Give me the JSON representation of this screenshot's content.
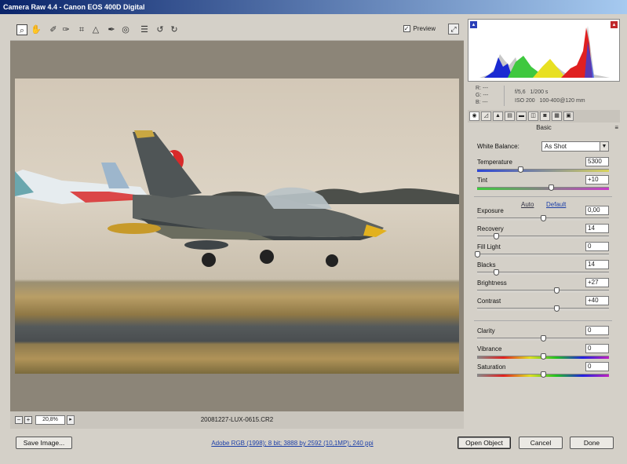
{
  "window": {
    "title": "Camera Raw 4.4  -  Canon EOS 400D Digital"
  },
  "toolbar": {
    "tools": [
      {
        "name": "zoom-tool-icon",
        "glyph": "⌕"
      },
      {
        "name": "hand-tool-icon",
        "glyph": "✋"
      },
      {
        "name": "white-balance-tool-icon",
        "glyph": "✐"
      },
      {
        "name": "color-sampler-tool-icon",
        "glyph": "✑"
      },
      {
        "name": "crop-tool-icon",
        "glyph": "⌗"
      },
      {
        "name": "straighten-tool-icon",
        "glyph": "△"
      },
      {
        "name": "retouch-tool-icon",
        "glyph": "✒"
      },
      {
        "name": "red-eye-tool-icon",
        "glyph": "◎"
      },
      {
        "name": "preferences-icon",
        "glyph": "☰"
      },
      {
        "name": "rotate-left-icon",
        "glyph": "↺"
      },
      {
        "name": "rotate-right-icon",
        "glyph": "↻"
      }
    ],
    "preview_label": "Preview",
    "preview_checked": true
  },
  "image": {
    "zoom": "20,8%",
    "filename": "20081227-LUX-0615.CR2"
  },
  "info": {
    "r": "R:  ---",
    "g": "G:  ---",
    "b": "B:  ---",
    "aperture": "f/5,6",
    "shutter": "1/200 s",
    "iso": "ISO 200",
    "lens": "100-400@120 mm"
  },
  "panel": {
    "title": "Basic",
    "white_balance_label": "White Balance:",
    "white_balance_value": "As Shot",
    "auto_label": "Auto",
    "default_label": "Default",
    "sliders": [
      {
        "id": "temperature",
        "label": "Temperature",
        "value": "5300",
        "pos": 0.33
      },
      {
        "id": "tint",
        "label": "Tint",
        "value": "+10",
        "pos": 0.56
      },
      {
        "id": "exposure",
        "label": "Exposure",
        "value": "0,00",
        "pos": 0.5
      },
      {
        "id": "recovery",
        "label": "Recovery",
        "value": "14",
        "pos": 0.14
      },
      {
        "id": "fill-light",
        "label": "Fill Light",
        "value": "0",
        "pos": 0.0
      },
      {
        "id": "blacks",
        "label": "Blacks",
        "value": "14",
        "pos": 0.14
      },
      {
        "id": "brightness",
        "label": "Brightness",
        "value": "+27",
        "pos": 0.6
      },
      {
        "id": "contrast",
        "label": "Contrast",
        "value": "+40",
        "pos": 0.6
      },
      {
        "id": "clarity",
        "label": "Clarity",
        "value": "0",
        "pos": 0.5
      },
      {
        "id": "vibrance",
        "label": "Vibrance",
        "value": "0",
        "pos": 0.5
      },
      {
        "id": "saturation",
        "label": "Saturation",
        "value": "0",
        "pos": 0.5
      }
    ]
  },
  "footer": {
    "save_label": "Save Image...",
    "workflow": "Adobe RGB (1998); 8 bit; 3888 by 2592 (10,1MP); 240 ppi",
    "open_label": "Open Object",
    "cancel_label": "Cancel",
    "done_label": "Done"
  }
}
